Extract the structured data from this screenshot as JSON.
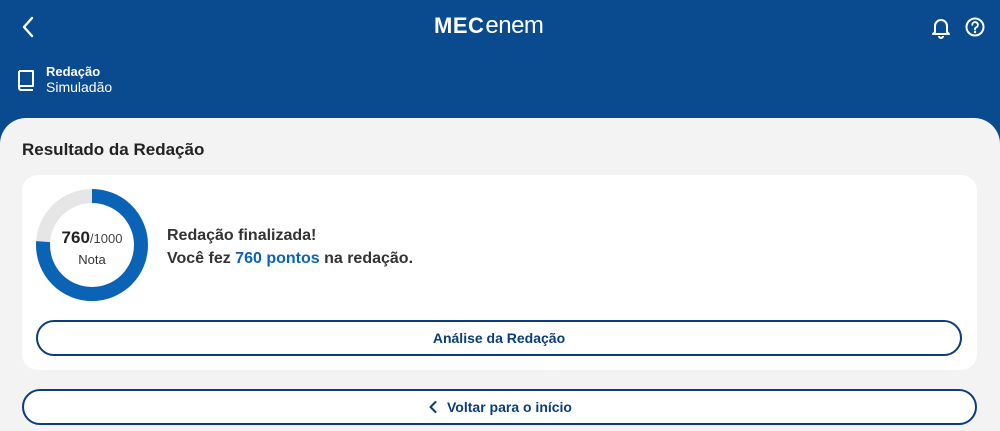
{
  "header": {
    "logo_mec": "MEC",
    "logo_enem": "enem",
    "back_icon": "chevron-left-icon",
    "bell_icon": "bell-icon",
    "help_icon": "help-circle-icon",
    "breadcrumb": {
      "icon": "book-icon",
      "title": "Redação",
      "subtitle": "Simuladão"
    }
  },
  "main": {
    "section_title": "Resultado da Redação",
    "result": {
      "score": "760",
      "max": "/1000",
      "score_label": "Nota",
      "progress_fraction": 0.76,
      "message_line1": "Redação finalizada!",
      "message_prefix": "Você fez ",
      "message_points": "760 pontos",
      "message_suffix": " na redação.",
      "analysis_button": "Análise da Redação"
    },
    "back_home_button": "Voltar para o início"
  },
  "colors": {
    "header_bg": "#0a4a8f",
    "progress": "#0b63b5",
    "track": "#e6e6e6",
    "button_border": "#0a3d7a"
  }
}
